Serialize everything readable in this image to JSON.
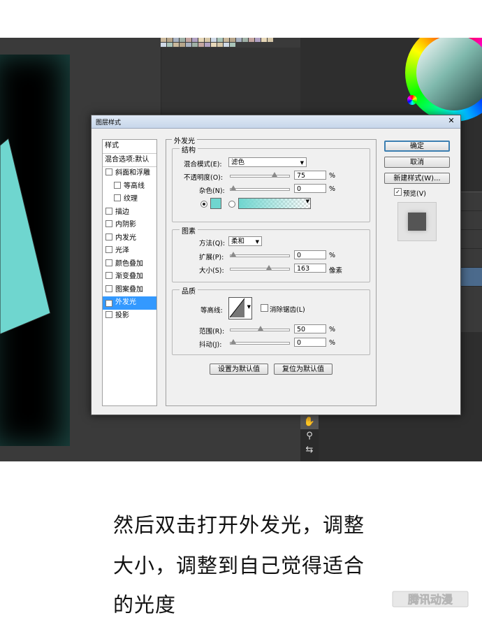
{
  "dialog": {
    "title": "图层样式",
    "close_label": "✕",
    "style_list": {
      "header": "样式",
      "blend_options": "混合选项:默认",
      "items": [
        {
          "label": "斜面和浮雕",
          "checked": false,
          "sub": false,
          "selected": false
        },
        {
          "label": "等高线",
          "checked": false,
          "sub": true,
          "selected": false
        },
        {
          "label": "纹理",
          "checked": false,
          "sub": true,
          "selected": false
        },
        {
          "label": "描边",
          "checked": false,
          "sub": false,
          "selected": false
        },
        {
          "label": "内阴影",
          "checked": false,
          "sub": false,
          "selected": false
        },
        {
          "label": "内发光",
          "checked": false,
          "sub": false,
          "selected": false
        },
        {
          "label": "光泽",
          "checked": false,
          "sub": false,
          "selected": false
        },
        {
          "label": "颜色叠加",
          "checked": false,
          "sub": false,
          "selected": false
        },
        {
          "label": "渐变叠加",
          "checked": false,
          "sub": false,
          "selected": false
        },
        {
          "label": "图案叠加",
          "checked": false,
          "sub": false,
          "selected": false
        },
        {
          "label": "外发光",
          "checked": true,
          "sub": false,
          "selected": true
        },
        {
          "label": "投影",
          "checked": false,
          "sub": false,
          "selected": false
        }
      ]
    },
    "outer_glow": {
      "section_title": "外发光",
      "structure": {
        "title": "结构",
        "blend_mode_label": "混合模式(E):",
        "blend_mode_value": "滤色",
        "opacity_label": "不透明度(O):",
        "opacity_value": "75",
        "noise_label": "杂色(N):",
        "noise_value": "0",
        "percent": "%",
        "glow_color": "#6fd6cf"
      },
      "elements": {
        "title": "图素",
        "technique_label": "方法(Q):",
        "technique_value": "柔和",
        "spread_label": "扩展(P):",
        "spread_value": "0",
        "size_label": "大小(S):",
        "size_value": "163",
        "size_unit": "像素",
        "percent": "%"
      },
      "quality": {
        "title": "品质",
        "contour_label": "等高线:",
        "antialias_label": "消除锯齿(L)",
        "range_label": "范围(R):",
        "range_value": "50",
        "jitter_label": "抖动(J):",
        "jitter_value": "0",
        "percent": "%"
      },
      "set_default_label": "设置为默认值",
      "reset_default_label": "复位为默认值"
    },
    "buttons": {
      "ok": "确定",
      "cancel": "取消",
      "new_style": "新建样式(W)...",
      "preview": "预览(V)"
    }
  },
  "slider_levels": {
    "opacity": 0.75,
    "noise": 0,
    "spread": 0,
    "size": 0.65,
    "range": 0.5,
    "jitter": 0
  },
  "caption": {
    "line1": "然后双击打开外发光，调整",
    "line2": "大小，调整到自己觉得适合",
    "line3": "的光度"
  },
  "watermark": "腾讯动漫",
  "colors": {
    "shape_fill": "#6fd6cf",
    "selection_blue": "#3399ff"
  }
}
